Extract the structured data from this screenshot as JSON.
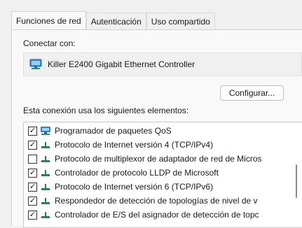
{
  "tabs": [
    {
      "label": "Funciones de red",
      "active": true
    },
    {
      "label": "Autenticación",
      "active": false
    },
    {
      "label": "Uso compartido",
      "active": false
    }
  ],
  "connect_label": "Conectar con:",
  "adapter": {
    "name": "Killer E2400 Gigabit Ethernet Controller",
    "icon": "network-adapter-icon"
  },
  "configure_button": "Configurar...",
  "items_label": "Esta conexión usa los siguientes elementos:",
  "items": [
    {
      "label": "Programador de paquetes QoS",
      "checked": true,
      "icon": "qos-network-icon"
    },
    {
      "label": "Protocolo de Internet versión 4 (TCP/IPv4)",
      "checked": true,
      "icon": "protocol-icon"
    },
    {
      "label": "Protocolo de multiplexor de adaptador de red de Micros",
      "checked": false,
      "icon": "protocol-icon"
    },
    {
      "label": "Controlador de protocolo LLDP de Microsoft",
      "checked": true,
      "icon": "protocol-icon"
    },
    {
      "label": "Protocolo de Internet versión 6 (TCP/IPv6)",
      "checked": true,
      "icon": "protocol-icon"
    },
    {
      "label": "Respondedor de detección de topologías de nivel de v",
      "checked": true,
      "icon": "protocol-icon"
    },
    {
      "label": "Controlador de E/S del asignador de detección de topc",
      "checked": true,
      "icon": "protocol-icon"
    }
  ],
  "colors": {
    "protocol_icon": "#1a8a4a",
    "qos_icon": "#3a7bd5"
  }
}
